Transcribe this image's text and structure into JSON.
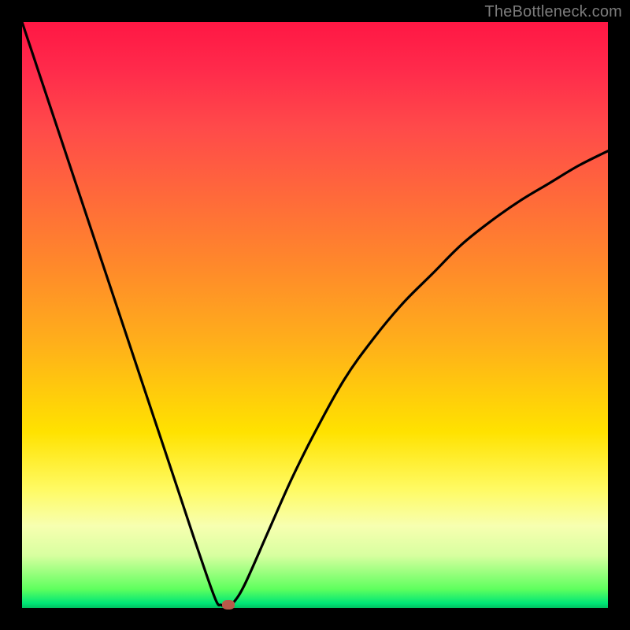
{
  "watermark": {
    "text": "TheBottleneck.com"
  },
  "chart_data": {
    "type": "line",
    "title": "",
    "xlabel": "",
    "ylabel": "",
    "xlim": [
      0,
      100
    ],
    "ylim": [
      0,
      100
    ],
    "grid": false,
    "legend": false,
    "series": [
      {
        "name": "bottleneck-curve",
        "color": "#000000",
        "x": [
          0,
          3,
          6,
          9,
          12,
          15,
          18,
          21,
          24,
          27,
          30,
          33,
          34,
          35,
          36,
          38,
          42,
          46,
          50,
          55,
          60,
          65,
          70,
          75,
          80,
          85,
          90,
          95,
          100
        ],
        "y": [
          100,
          91,
          82,
          73,
          64,
          55,
          46,
          37,
          28,
          19,
          10,
          1.5,
          0.5,
          0,
          0.8,
          4,
          13,
          22,
          30,
          39,
          46,
          52,
          57,
          62,
          66,
          69.5,
          72.5,
          75.5,
          78
        ]
      }
    ],
    "markers": [
      {
        "name": "vertex-marker",
        "x": 35.2,
        "y": 0.5,
        "color": "#b85a4a"
      }
    ],
    "background_gradient": {
      "direction": "top-to-bottom",
      "stops": [
        {
          "pos": 0,
          "color": "#ff1744"
        },
        {
          "pos": 0.3,
          "color": "#ff6a3a"
        },
        {
          "pos": 0.55,
          "color": "#ffb01a"
        },
        {
          "pos": 0.8,
          "color": "#fffb66"
        },
        {
          "pos": 0.97,
          "color": "#5eff5e"
        },
        {
          "pos": 1.0,
          "color": "#00c060"
        }
      ]
    }
  }
}
